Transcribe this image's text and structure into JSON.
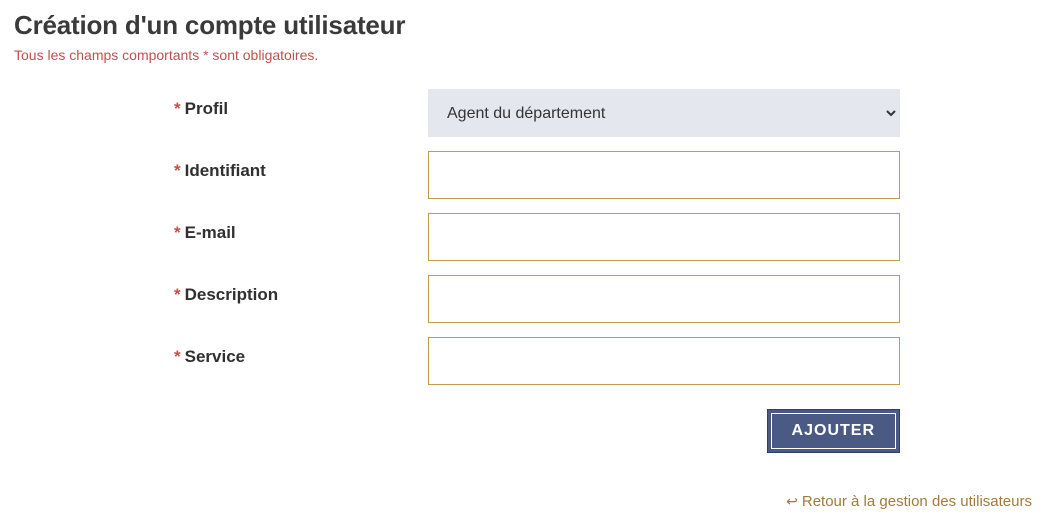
{
  "heading": "Création d'un compte utilisateur",
  "required_note": "Tous les champs comportants * sont obligatoires.",
  "form": {
    "profil": {
      "label": "Profil",
      "selected": "Agent du département"
    },
    "identifiant": {
      "label": "Identifiant",
      "value": ""
    },
    "email": {
      "label": "E-mail",
      "value": ""
    },
    "description": {
      "label": "Description",
      "value": ""
    },
    "service": {
      "label": "Service",
      "value": ""
    }
  },
  "actions": {
    "submit": "AJOUTER"
  },
  "back_link": "Retour à la gestion des utilisateurs"
}
